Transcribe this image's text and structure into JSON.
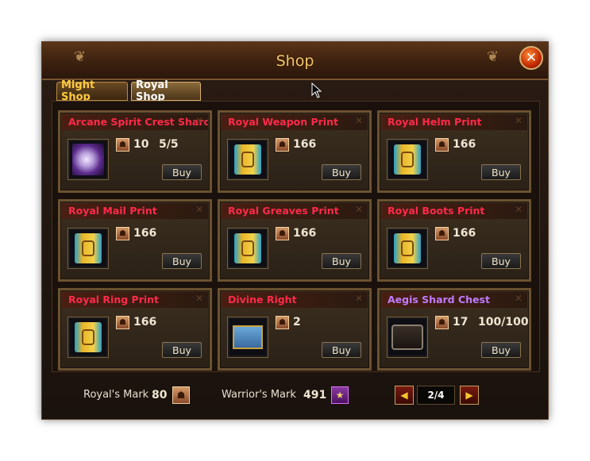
{
  "window": {
    "title": "Shop"
  },
  "tabs": [
    {
      "label": "Might Shop",
      "active": false
    },
    {
      "label": "Royal Shop",
      "active": true
    }
  ],
  "items": [
    {
      "name": "Arcane Spirit Crest Shard",
      "name_color": "red",
      "icon": "crest-shard-icon",
      "price": "10",
      "limit": "5/5",
      "buy": "Buy"
    },
    {
      "name": "Royal Weapon Print",
      "name_color": "red",
      "icon": "weapon-print-icon",
      "price": "166",
      "limit": "",
      "buy": "Buy"
    },
    {
      "name": "Royal Helm Print",
      "name_color": "red",
      "icon": "helm-print-icon",
      "price": "166",
      "limit": "",
      "buy": "Buy"
    },
    {
      "name": "Royal Mail Print",
      "name_color": "red",
      "icon": "mail-print-icon",
      "price": "166",
      "limit": "",
      "buy": "Buy"
    },
    {
      "name": "Royal Greaves Print",
      "name_color": "red",
      "icon": "greaves-print-icon",
      "price": "166",
      "limit": "",
      "buy": "Buy"
    },
    {
      "name": "Royal Boots Print",
      "name_color": "red",
      "icon": "boots-print-icon",
      "price": "166",
      "limit": "",
      "buy": "Buy"
    },
    {
      "name": "Royal Ring Print",
      "name_color": "red",
      "icon": "ring-print-icon",
      "price": "166",
      "limit": "",
      "buy": "Buy"
    },
    {
      "name": "Divine Right",
      "name_color": "red",
      "icon": "divine-right-chest-icon",
      "price": "2",
      "limit": "",
      "buy": "Buy"
    },
    {
      "name": "Aegis Shard Chest",
      "name_color": "purple",
      "icon": "aegis-chest-icon",
      "price": "17",
      "limit": "100/100",
      "buy": "Buy"
    }
  ],
  "footer": {
    "royals_mark_label": "Royal's Mark",
    "royals_mark_value": "80",
    "warriors_mark_label": "Warrior's Mark",
    "warriors_mark_value": "491",
    "page": "2/4"
  },
  "colors": {
    "red_name": "#ff2a4a",
    "purple_name": "#c07bff",
    "title": "#f3c66b"
  }
}
